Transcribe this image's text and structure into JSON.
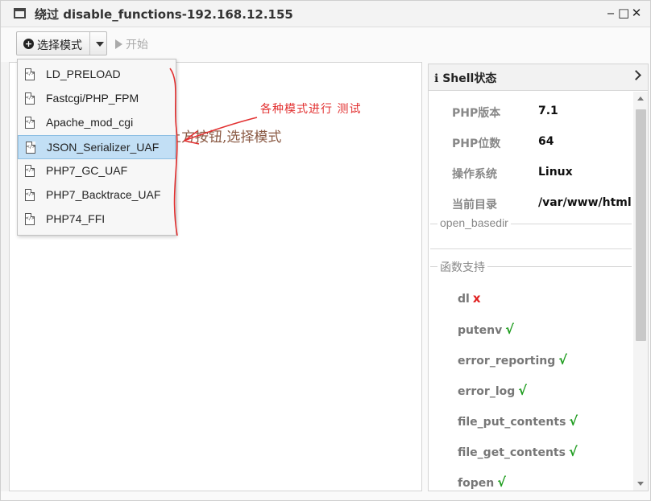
{
  "window": {
    "title": "绕过 disable_functions-192.168.12.155",
    "controls": [
      "minimize",
      "maximize",
      "close"
    ]
  },
  "toolbar": {
    "mode_button_label": "选择模式",
    "start_button_label": "开始"
  },
  "mode_menu": {
    "items": [
      "LD_PRELOAD",
      "Fastcgi/PHP_FPM",
      "Apache_mod_cgi",
      "JSON_Serializer_UAF",
      "PHP7_GC_UAF",
      "PHP7_Backtrace_UAF",
      "PHP74_FFI"
    ],
    "selected": "JSON_Serializer_UAF"
  },
  "main": {
    "hint": "上方按钮,选择模式"
  },
  "annotation": {
    "text": "各种模式进行 测试"
  },
  "shell_panel": {
    "title": "Shell状态",
    "info": [
      {
        "key": "PHP版本",
        "value": "7.1"
      },
      {
        "key": "PHP位数",
        "value": "64"
      },
      {
        "key": "操作系统",
        "value": "Linux"
      },
      {
        "key": "当前目录",
        "value": "/var/www/html"
      }
    ],
    "open_basedir_legend": "open_basedir",
    "functions_legend": "函数支持",
    "functions": [
      {
        "name": "dl",
        "status": "x"
      },
      {
        "name": "putenv",
        "status": "√"
      },
      {
        "name": "error_reporting",
        "status": "√"
      },
      {
        "name": "error_log",
        "status": "√"
      },
      {
        "name": "file_put_contents",
        "status": "√"
      },
      {
        "name": "file_get_contents",
        "status": "√"
      },
      {
        "name": "fopen",
        "status": "√"
      }
    ]
  },
  "colors": {
    "supported": "#1f9d1f",
    "unsupported": "#e02020",
    "selected_item": "#c2dff5",
    "annotation": "#e23030"
  }
}
